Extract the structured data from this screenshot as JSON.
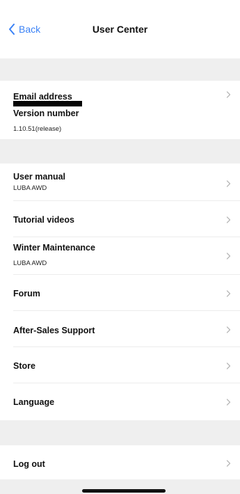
{
  "nav": {
    "back_label": "Back",
    "title": "User Center",
    "accent_color": "#3b82f6"
  },
  "account": {
    "email_label": "Email address",
    "version_label": "Version number",
    "version_value": "1.10.51(release)"
  },
  "resources": {
    "user_manual_label": "User manual",
    "user_manual_sub": "LUBA AWD",
    "tutorial_label": "Tutorial videos",
    "winter_label": "Winter Maintenance",
    "winter_sub": "LUBA AWD",
    "forum_label": "Forum",
    "after_sales_label": "After-Sales Support",
    "store_label": "Store",
    "language_label": "Language"
  },
  "session": {
    "logout_label": "Log out"
  },
  "icons": {
    "back": "chevron-left-icon",
    "row": "chevron-right-icon"
  }
}
